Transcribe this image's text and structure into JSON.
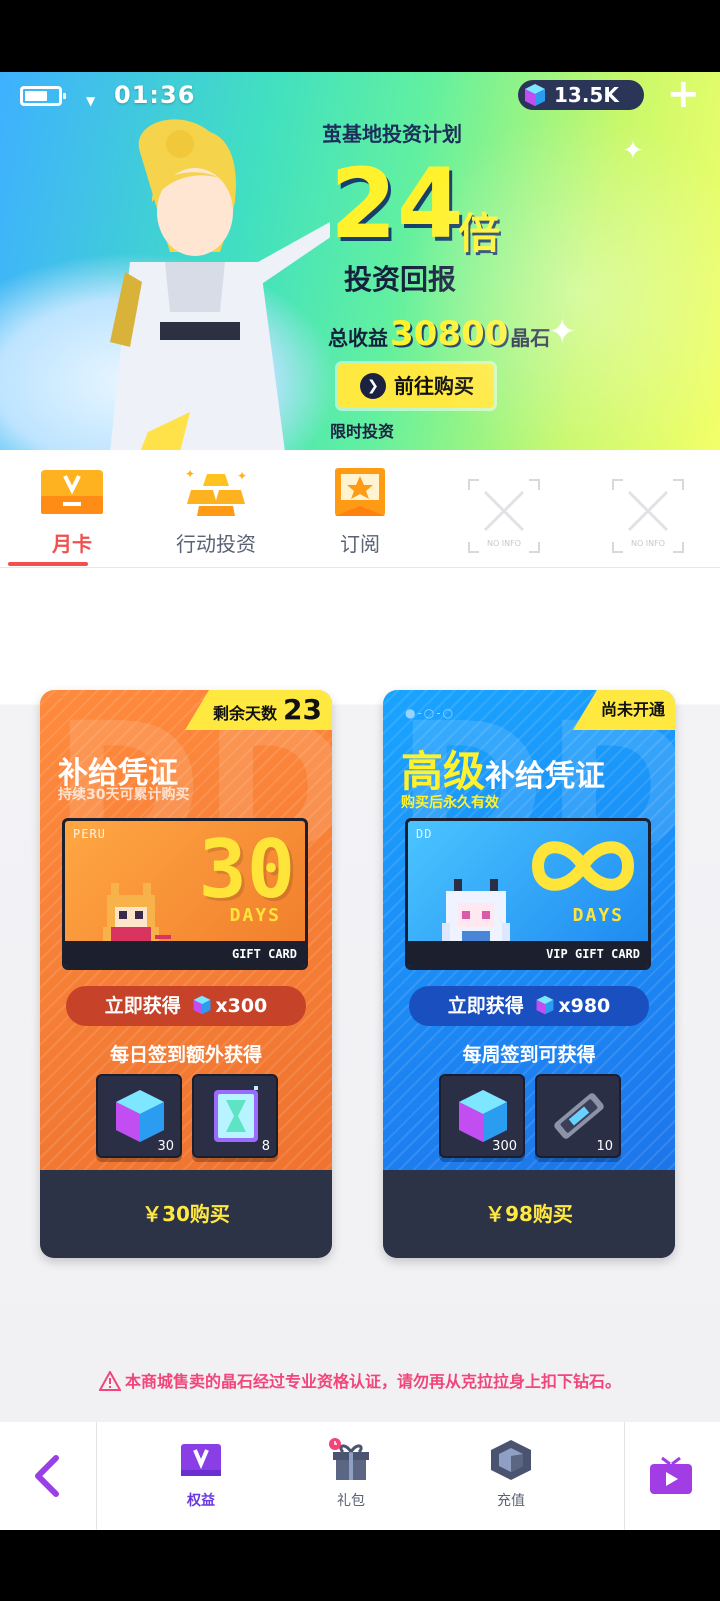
{
  "status_bar": {
    "time": "01:36",
    "crystals": "13.5K",
    "add_symbol": "+"
  },
  "banner": {
    "plan_title": "茧基地投资计划",
    "multiplier": "24",
    "multiplier_unit": "倍",
    "return_label": "投资回报",
    "total_prefix": "总收益",
    "total_amount": "30800",
    "total_suffix": "晶石",
    "buy_button": "前往购买",
    "limited_label": "限时投资"
  },
  "tabs": [
    {
      "label": "月卡",
      "active": true
    },
    {
      "label": "行动投资",
      "active": false
    },
    {
      "label": "订阅",
      "active": false
    },
    {
      "label": "NO INFO",
      "active": false
    },
    {
      "label": "NO INFO",
      "active": false
    }
  ],
  "cards": [
    {
      "badge_label": "剩余天数",
      "badge_value": "23",
      "title": "补给凭证",
      "subtitle": "持续30天可累计购买",
      "gift_brand": "PERU",
      "gift_number": "30",
      "gift_days": "DAYS",
      "gift_strip": "GIFT CARD",
      "instant_label": "立即获得",
      "instant_amount": "x300",
      "daily_label": "每日签到额外获得",
      "rewards": [
        {
          "icon": "crystal-cube",
          "qty": "30"
        },
        {
          "icon": "hourglass-chip",
          "qty": "8"
        }
      ],
      "price_label": "￥30购买"
    },
    {
      "badge_label": "尚未开通",
      "title_big": "高级",
      "title": "补给凭证",
      "subtitle": "购买后永久有效",
      "gift_brand": "DD",
      "gift_days": "DAYS",
      "gift_strip": "VIP GIFT CARD",
      "instant_label": "立即获得",
      "instant_amount": "x980",
      "daily_label": "每周签到可获得",
      "rewards": [
        {
          "icon": "crystal-cube",
          "qty": "300"
        },
        {
          "icon": "ticket-chip",
          "qty": "10"
        }
      ],
      "price_label": "￥98购买"
    }
  ],
  "notice": "本商城售卖的晶石经过专业资格认证，请勿再从克拉拉身上扣下钻石。",
  "bottom_nav": [
    {
      "label": "权益",
      "icon": "v-card-icon",
      "active": true
    },
    {
      "label": "礼包",
      "icon": "gift-icon",
      "active": false
    },
    {
      "label": "充值",
      "icon": "cube-icon",
      "active": false
    }
  ],
  "colors": {
    "accent_red": "#f24f4f",
    "accent_yellow": "#ffe940",
    "accent_purple": "#6a37e0",
    "orange_card": "#f37b34",
    "blue_card": "#1d7ef0"
  }
}
